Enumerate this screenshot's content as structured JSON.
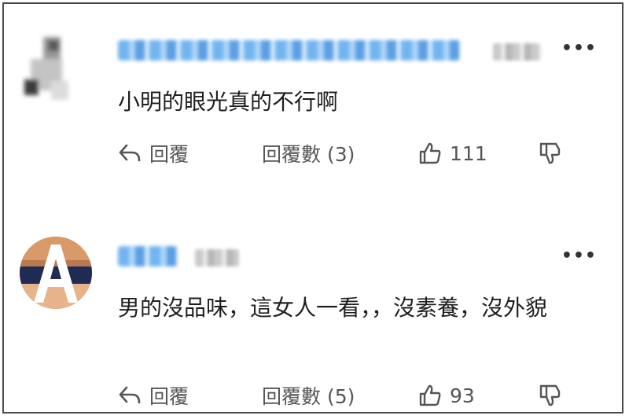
{
  "comments": [
    {
      "text": "小明的眼光真的不行啊",
      "reply_label": "回覆",
      "reply_count_label": "回覆數 (3)",
      "likes": "111"
    },
    {
      "text": "男的沒品味，這女人一看，，沒素養，沒外貌",
      "reply_label": "回覆",
      "reply_count_label": "回覆數 (5)",
      "likes": "93"
    }
  ],
  "more_icon": "more-dots-icon",
  "colors": {
    "blur_blue": "#5aa8ee",
    "text": "#1f1f1f",
    "secondary": "#555555",
    "border": "#4a4a4a"
  }
}
